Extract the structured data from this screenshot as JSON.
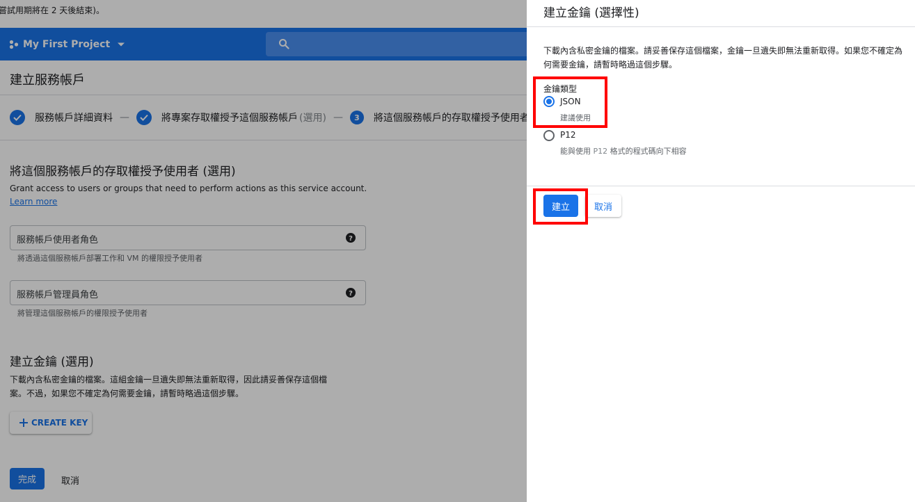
{
  "trial_notice": "嘗試用期將在 2 天後結束)。",
  "header": {
    "project_name": "My First Project",
    "project_icon": "hexagon-nodes-icon",
    "search_icon": "search-icon"
  },
  "page": {
    "title": "建立服務帳戶",
    "steps": [
      {
        "label": "服務帳戶詳細資料",
        "state": "done"
      },
      {
        "label": "將專案存取權授予這個服務帳戶",
        "optional": "(選用)",
        "state": "done"
      },
      {
        "number": "3",
        "label": "將這個服務帳戶的存取權授予使用者 (選用)",
        "state": "active"
      }
    ],
    "step_separator": "—",
    "section_access": {
      "title": "將這個服務帳戶的存取權授予使用者 (選用)",
      "description": "Grant access to users or groups that need to perform actions as this service account.",
      "learn_more": "Learn more",
      "user_role": {
        "label": "服務帳戶使用者角色",
        "hint": "將透過這個服務帳戶部署工作和 VM 的權限授予使用者"
      },
      "admin_role": {
        "label": "服務帳戶管理員角色",
        "hint": "將管理這個服務帳戶的權限授予使用者"
      }
    },
    "section_key": {
      "title": "建立金鑰 (選用)",
      "description_line1": "下載內含私密金鑰的檔案。這組金鑰一旦遺失即無法重新取得，因此請妥善保存這個檔",
      "description_line2": "案。不過，如果您不確定為何需要金鑰，請暫時略過這個步驟。",
      "create_key": "CREATE KEY"
    },
    "done_button": "完成",
    "cancel_button": "取消"
  },
  "drawer": {
    "title": "建立金鑰 (選擇性)",
    "description": "下載內含私密金鑰的檔案。請妥善保存這個檔案，金鑰一旦遺失即無法重新取得。如果您不確定為何需要金鑰，請暫時略過這個步驟。",
    "key_type_label": "金鑰類型",
    "options": [
      {
        "label": "JSON",
        "sub": "建議使用",
        "selected": true
      },
      {
        "label": "P12",
        "sub_prefix": "能與使用 ",
        "sub_highlight": "P12",
        "sub_suffix": " 格式的程式碼向下相容",
        "selected": false
      }
    ],
    "create_button": "建立",
    "cancel_button": "取消"
  },
  "colors": {
    "primary": "#1a73e8",
    "highlight_box": "#ff0000",
    "overlay": "rgba(0,0,0,0.32)"
  }
}
